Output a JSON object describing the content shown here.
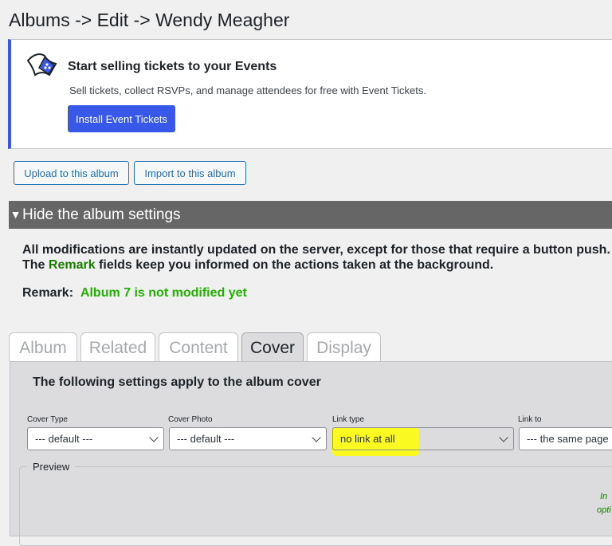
{
  "page": {
    "title": "Albums -> Edit -> Wendy Meagher"
  },
  "notice": {
    "title": "Start selling tickets to your Events",
    "text": "Sell tickets, collect RSVPs, and manage attendees for free with Event Tickets.",
    "button": "Install Event Tickets",
    "icon": "ticket-icon",
    "accent": "#3858e9"
  },
  "actions": {
    "upload": "Upload to this album",
    "import": "Import to this album"
  },
  "settings": {
    "toggle": "Hide the album settings",
    "line1": "All modifications are instantly updated on the server, except for those that require a button push.",
    "line2_pre": "The ",
    "line2_highlight": "Remark",
    "line2_post": " fields keep you informed on the actions taken at the background.",
    "remark_label": "Remark:",
    "remark_value": "Album 7 is not modified yet"
  },
  "tabs": [
    {
      "label": "Album",
      "active": false
    },
    {
      "label": "Related",
      "active": false
    },
    {
      "label": "Content",
      "active": false
    },
    {
      "label": "Cover",
      "active": true
    },
    {
      "label": "Display",
      "active": false
    }
  ],
  "cover": {
    "heading": "The following settings apply to the album cover",
    "fields": [
      {
        "label": "Cover Type",
        "value": "--- default ---"
      },
      {
        "label": "Cover Photo",
        "value": "--- default ---"
      },
      {
        "label": "Link type",
        "value": "no link at all"
      },
      {
        "label": "Link to",
        "value": "--- the same page"
      }
    ],
    "preview_label": "Preview",
    "preview_note_1": "In",
    "preview_note_2": "opti"
  }
}
